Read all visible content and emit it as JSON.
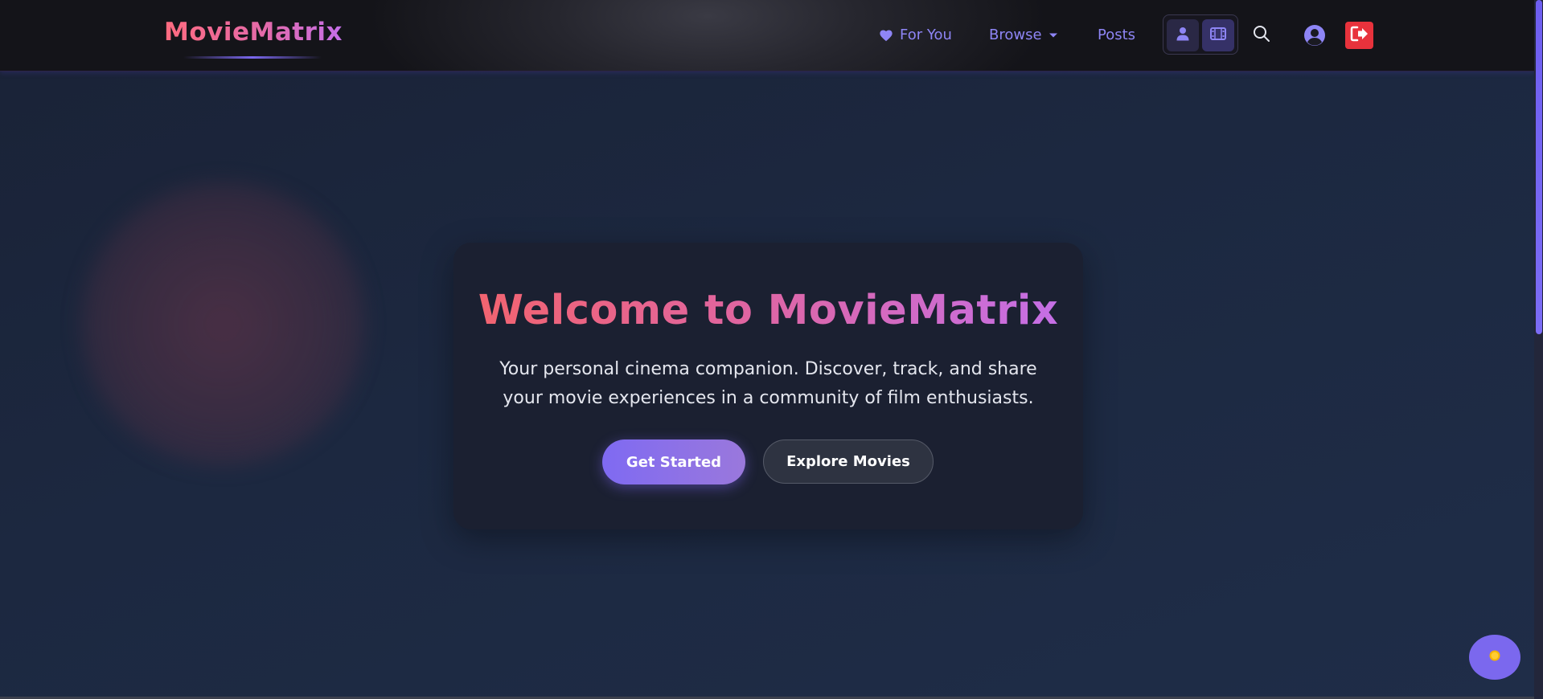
{
  "brand": {
    "name": "MovieMatrix"
  },
  "nav": {
    "for_you": "For You",
    "browse": "Browse",
    "posts": "Posts"
  },
  "icons": {
    "heart": "heart-icon",
    "caret": "caret-down-icon",
    "person": "user-icon",
    "film": "film-icon",
    "search": "search-icon",
    "profile": "user-circle-icon",
    "logout": "sign-out-icon",
    "theme": "sun-icon"
  },
  "hero": {
    "title": "Welcome to MovieMatrix",
    "subtitle": "Your personal cinema companion. Discover, track, and share your movie experiences in a community of film enthusiasts.",
    "primary_button": "Get Started",
    "secondary_button": "Explore Movies"
  },
  "colors": {
    "accent": "#7b68ee",
    "link": "#8e85f5",
    "logout": "#e8323c",
    "title_gradient_start": "#f26470",
    "title_gradient_end": "#c56fe6"
  }
}
